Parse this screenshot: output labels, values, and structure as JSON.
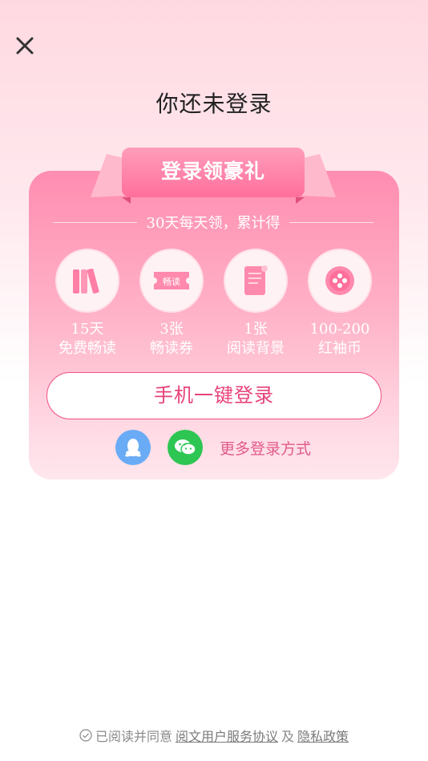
{
  "header": {
    "title": "你还未登录"
  },
  "card": {
    "ribbon_label": "登录领豪礼",
    "subtitle": "30天每天领，累计得",
    "benefits": [
      {
        "line1": "15天",
        "line2": "免费畅读",
        "icon": "books-icon"
      },
      {
        "line1": "3张",
        "line2": "畅读券",
        "icon": "ticket-icon",
        "icon_text": "畅读"
      },
      {
        "line1": "1张",
        "line2": "阅读背景",
        "icon": "document-icon"
      },
      {
        "line1": "100-200",
        "line2": "红袖币",
        "icon": "coin-icon"
      }
    ],
    "phone_login_label": "手机一键登录",
    "more_login_label": "更多登录方式"
  },
  "footer": {
    "prefix": "已阅读并同意",
    "service_link": "阅文用户服务协议",
    "and": "及",
    "privacy_link": "隐私政策"
  },
  "colors": {
    "accent": "#e8427a",
    "card_top": "#ff8db1",
    "qq": "#6aabf5",
    "wechat": "#2dc653"
  }
}
